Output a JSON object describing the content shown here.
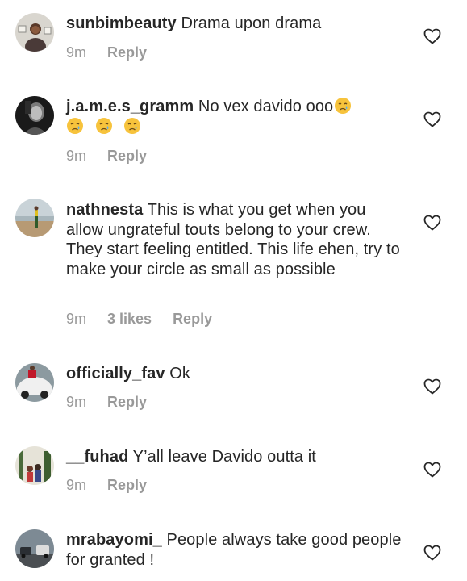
{
  "comments": [
    {
      "username": "sunbimbeauty",
      "text": " Drama upon drama",
      "time": "9m",
      "likes": "",
      "reply": "Reply",
      "avatar": "avatar-woman-framed-photos"
    },
    {
      "username": "j.a.m.e.s_gramm",
      "text": " No vex davido ooo",
      "emoji_line": [
        "crying-face",
        "crying-face",
        "crying-face",
        "crying-face"
      ],
      "time": "9m",
      "likes": "",
      "reply": "Reply",
      "avatar": "avatar-bw-portrait"
    },
    {
      "username": "nathnesta",
      "text": " This is what you get when you allow ungrateful touts belong to your crew. They start feeling entitled. This life ehen, try to make your circle as small as possible",
      "time": "9m",
      "likes": "3 likes",
      "reply": "Reply",
      "avatar": "avatar-beach-person"
    },
    {
      "username": "officially_fav",
      "text": " Ok",
      "time": "9m",
      "likes": "",
      "reply": "Reply",
      "avatar": "avatar-white-car"
    },
    {
      "username": "__fuhad",
      "text": " Y’all leave Davido outta it",
      "time": "9m",
      "likes": "",
      "reply": "Reply",
      "avatar": "avatar-group-trees"
    },
    {
      "username": "mrabayomi_",
      "text": " People always take good people for granted !",
      "time": "",
      "likes": "",
      "reply": "",
      "avatar": "avatar-cars-road"
    }
  ],
  "icons": {
    "like": "heart-outline-icon",
    "emoji": "crying-face-emoji"
  },
  "colors": {
    "text": "#262626",
    "meta": "#999999",
    "heart": "#262626",
    "emoji": "#F7C33C",
    "tear": "#5DADEC"
  }
}
